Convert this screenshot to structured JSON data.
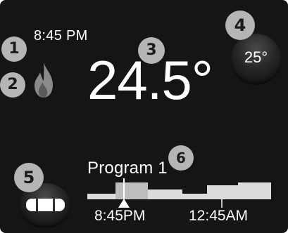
{
  "status": {
    "time": "8:45 PM",
    "heating_icon": "flame-icon"
  },
  "temperature": {
    "current": "24.5°"
  },
  "setpoint": {
    "value": "25°"
  },
  "mode": {
    "icon": "three-segment-mode-icon"
  },
  "program": {
    "name": "Program 1",
    "now_label": "8:45PM",
    "next_label": "12:45AM"
  },
  "callouts": [
    "1",
    "2",
    "3",
    "4",
    "5",
    "6"
  ],
  "colors": {
    "background": "#151515",
    "text": "#ffffff",
    "badge": "#b5b5b5",
    "icon_gray": "#8a8a8a",
    "schedule_bar": "#dcdcdc",
    "schedule_current": "#bdbdbd"
  }
}
